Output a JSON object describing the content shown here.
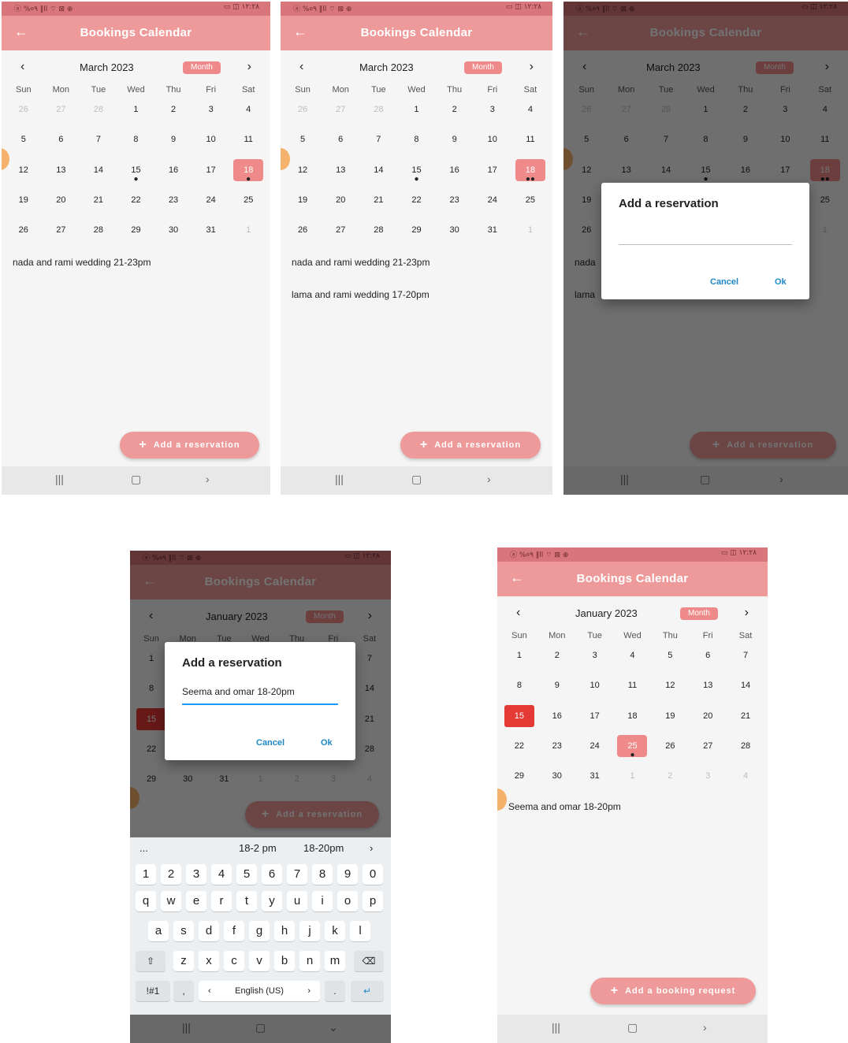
{
  "app_title": "Bookings Calendar",
  "status": {
    "left": "ⓐ %०٩ ‖ll ⌔ ⊠ ⊕",
    "right": "▭ ◫ ١٢:٢٨"
  },
  "nav_icons": {
    "back": "arrow-back-icon",
    "prev": "chevron-left-icon",
    "next": "chevron-right-icon"
  },
  "format_button": "Month",
  "weekdays": [
    "Sun",
    "Mon",
    "Tue",
    "Wed",
    "Thu",
    "Fri",
    "Sat"
  ],
  "march": {
    "month_label": "March 2023",
    "days": [
      "26",
      "27",
      "28",
      "1",
      "2",
      "3",
      "4",
      "5",
      "6",
      "7",
      "8",
      "9",
      "10",
      "11",
      "12",
      "13",
      "14",
      "15",
      "16",
      "17",
      "18",
      "19",
      "20",
      "21",
      "22",
      "23",
      "24",
      "25",
      "26",
      "27",
      "28",
      "29",
      "30",
      "31",
      "1"
    ],
    "out_flags": [
      1,
      1,
      1,
      0,
      0,
      0,
      0,
      0,
      0,
      0,
      0,
      0,
      0,
      0,
      0,
      0,
      0,
      0,
      0,
      0,
      0,
      0,
      0,
      0,
      0,
      0,
      0,
      0,
      0,
      0,
      0,
      0,
      0,
      0,
      1
    ]
  },
  "january": {
    "month_label": "January 2023",
    "days": [
      "1",
      "2",
      "3",
      "4",
      "5",
      "6",
      "7",
      "8",
      "9",
      "10",
      "11",
      "12",
      "13",
      "14",
      "15",
      "16",
      "17",
      "18",
      "19",
      "20",
      "21",
      "22",
      "23",
      "24",
      "25",
      "26",
      "27",
      "28",
      "29",
      "30",
      "31",
      "1",
      "2",
      "3",
      "4"
    ],
    "out_flags": [
      0,
      0,
      0,
      0,
      0,
      0,
      0,
      0,
      0,
      0,
      0,
      0,
      0,
      0,
      0,
      0,
      0,
      0,
      0,
      0,
      0,
      0,
      0,
      0,
      0,
      0,
      0,
      0,
      0,
      0,
      0,
      1,
      1,
      1,
      1
    ]
  },
  "screens": [
    {
      "events": [
        "nada and rami wedding 21-23pm"
      ],
      "fab": "Add a reservation"
    },
    {
      "events": [
        "nada and rami wedding 21-23pm",
        "lama and rami wedding 17-20pm"
      ],
      "fab": "Add a reservation"
    },
    {
      "events": [
        "nada",
        "lama"
      ],
      "fab": "Add a reservation",
      "dialog": {
        "title": "Add a reservation",
        "value": "",
        "cancel": "Cancel",
        "ok": "Ok"
      }
    },
    {
      "fab": "Add a reservation",
      "dialog": {
        "title": "Add a reservation",
        "value": "Seema and omar 18-20pm",
        "cancel": "Cancel",
        "ok": "Ok"
      },
      "keyboard": {
        "suggestions": [
          "...",
          "18-2 pm",
          "18-20pm"
        ],
        "row_digits": [
          "1",
          "2",
          "3",
          "4",
          "5",
          "6",
          "7",
          "8",
          "9",
          "0"
        ],
        "row_1": [
          "q",
          "w",
          "e",
          "r",
          "t",
          "y",
          "u",
          "i",
          "o",
          "p"
        ],
        "row_2": [
          "a",
          "s",
          "d",
          "f",
          "g",
          "h",
          "j",
          "k",
          "l"
        ],
        "row_3": [
          "z",
          "x",
          "c",
          "v",
          "b",
          "n",
          "m"
        ],
        "symbols": "!#1",
        "comma": ",",
        "space": "English (US)",
        "period": "."
      }
    },
    {
      "events": [
        "Seema and omar 18-20pm"
      ],
      "fab": "Add a booking request"
    }
  ]
}
